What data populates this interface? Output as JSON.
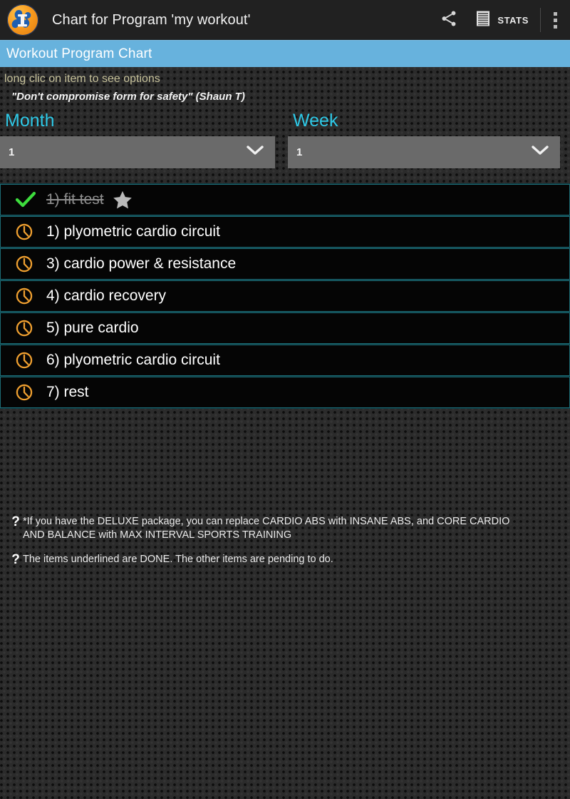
{
  "toolbar": {
    "app_icon": "muscle-figure-app-icon",
    "title": "Chart for Program 'my workout'",
    "share_icon": "share-icon",
    "stats_icon": "document-lines-icon",
    "stats_label": "STATS",
    "overflow_icon": "overflow-menu-icon"
  },
  "band": {
    "title": "Workout Program Chart",
    "color": "#67b2dd"
  },
  "hint": "long clic on item to see options",
  "quote": "\"Don't compromise form for safety\" (Shaun T)",
  "selectors": [
    {
      "label": "Month",
      "value": "1",
      "chevron_icon": "chevron-down-icon",
      "label_color": "#2ec8e6"
    },
    {
      "label": "Week",
      "value": "1",
      "chevron_icon": "chevron-down-icon",
      "label_color": "#2ec8e6"
    }
  ],
  "list": {
    "items": [
      {
        "icon": "check-icon",
        "icon_color": "#3ddc3d",
        "label": "1) fit test",
        "done": true,
        "star": true,
        "star_icon": "star-icon"
      },
      {
        "icon": "clock-icon",
        "icon_color": "#f0a030",
        "label": "1) plyometric cardio circuit",
        "done": false,
        "star": false
      },
      {
        "icon": "clock-icon",
        "icon_color": "#f0a030",
        "label": "3) cardio power & resistance",
        "done": false,
        "star": false
      },
      {
        "icon": "clock-icon",
        "icon_color": "#f0a030",
        "label": "4) cardio recovery",
        "done": false,
        "star": false
      },
      {
        "icon": "clock-icon",
        "icon_color": "#f0a030",
        "label": "5) pure cardio",
        "done": false,
        "star": false
      },
      {
        "icon": "clock-icon",
        "icon_color": "#f0a030",
        "label": "6) plyometric cardio circuit",
        "done": false,
        "star": false
      },
      {
        "icon": "clock-icon",
        "icon_color": "#f0a030",
        "label": "7) rest",
        "done": false,
        "star": false
      }
    ]
  },
  "notes": [
    {
      "bullet": "?",
      "text": "*If you have the DELUXE package, you can replace CARDIO ABS with INSANE ABS, and CORE CARDIO AND BALANCE with MAX INTERVAL SPORTS TRAINING"
    },
    {
      "bullet": "?",
      "text": "The items underlined are DONE. The other items are pending to do."
    }
  ]
}
